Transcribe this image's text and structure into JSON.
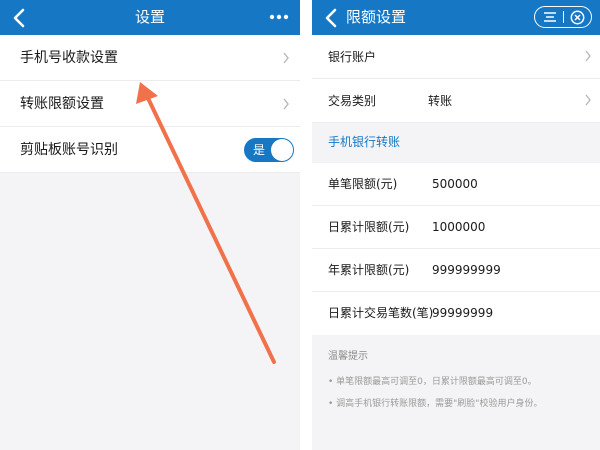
{
  "left": {
    "title": "设置",
    "rows": [
      {
        "label": "手机号收款设置"
      },
      {
        "label": "转账限额设置"
      },
      {
        "label": "剪贴板账号识别",
        "toggle_text": "是"
      }
    ]
  },
  "right": {
    "title": "限额设置",
    "bank_account_label": "银行账户",
    "transaction_type_label": "交易类别",
    "transaction_type_value": "转账",
    "section_title": "手机银行转账",
    "limits": [
      {
        "label": "单笔限额(元)",
        "value": "500000"
      },
      {
        "label": "日累计限额(元)",
        "value": "1000000"
      },
      {
        "label": "年累计限额(元)",
        "value": "999999999"
      },
      {
        "label": "日累计交易笔数(笔)",
        "value": "99999999"
      }
    ],
    "tips_title": "温馨提示",
    "tips": [
      "• 单笔限额最高可调至0，日累计限额最高可调至0。",
      "• 调高手机银行转账限额，需要\"刷脸\"校验用户身份。"
    ]
  },
  "colors": {
    "header": "#1677c5",
    "annotation_arrow": "#f0714a"
  }
}
